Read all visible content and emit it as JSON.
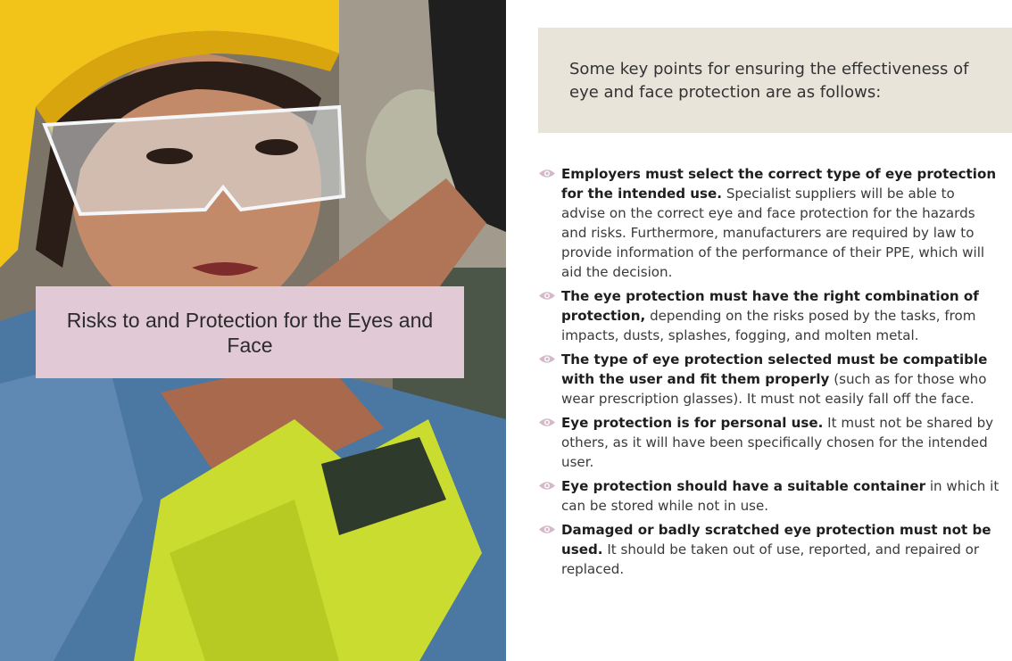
{
  "title_box": {
    "text": "Risks to and Protection for the Eyes and Face"
  },
  "intro": {
    "text": "Some key points for ensuring the effectiveness of eye and face protection are as follows:"
  },
  "points": [
    {
      "bold": "Employers must select the correct type of eye protection for the intended use.",
      "rest": " Specialist suppliers will be able to advise on the correct eye and face protection for the hazards and risks. Furthermore, manufacturers are required by law to provide information of the performance of their PPE, which will aid the decision."
    },
    {
      "bold": "The eye protection must have the right combination of protection,",
      "rest": " depending on the risks posed by the tasks, from impacts, dusts, splashes, fogging, and molten metal."
    },
    {
      "bold": "The type of eye protection selected must be compatible with the user and fit them properly",
      "rest": " (such as for those who wear prescription glasses). It must not easily fall off the face."
    },
    {
      "bold": "Eye protection is for personal use.",
      "rest": " It must not be shared by others, as it will have been specifically chosen for the intended user."
    },
    {
      "bold": "Eye protection should have a suitable container",
      "rest": " in which it can be stored while not in use."
    },
    {
      "bold": "Damaged or badly scratched eye protection must not be used.",
      "rest": " It should be taken out of use, reported, and repaired or replaced."
    }
  ],
  "icons": {
    "bullet": "eye-icon"
  },
  "colors": {
    "title_box_bg": "#e1c9d6",
    "intro_box_bg": "#e8e4da",
    "bullet_icon": "#d6b9c9"
  }
}
